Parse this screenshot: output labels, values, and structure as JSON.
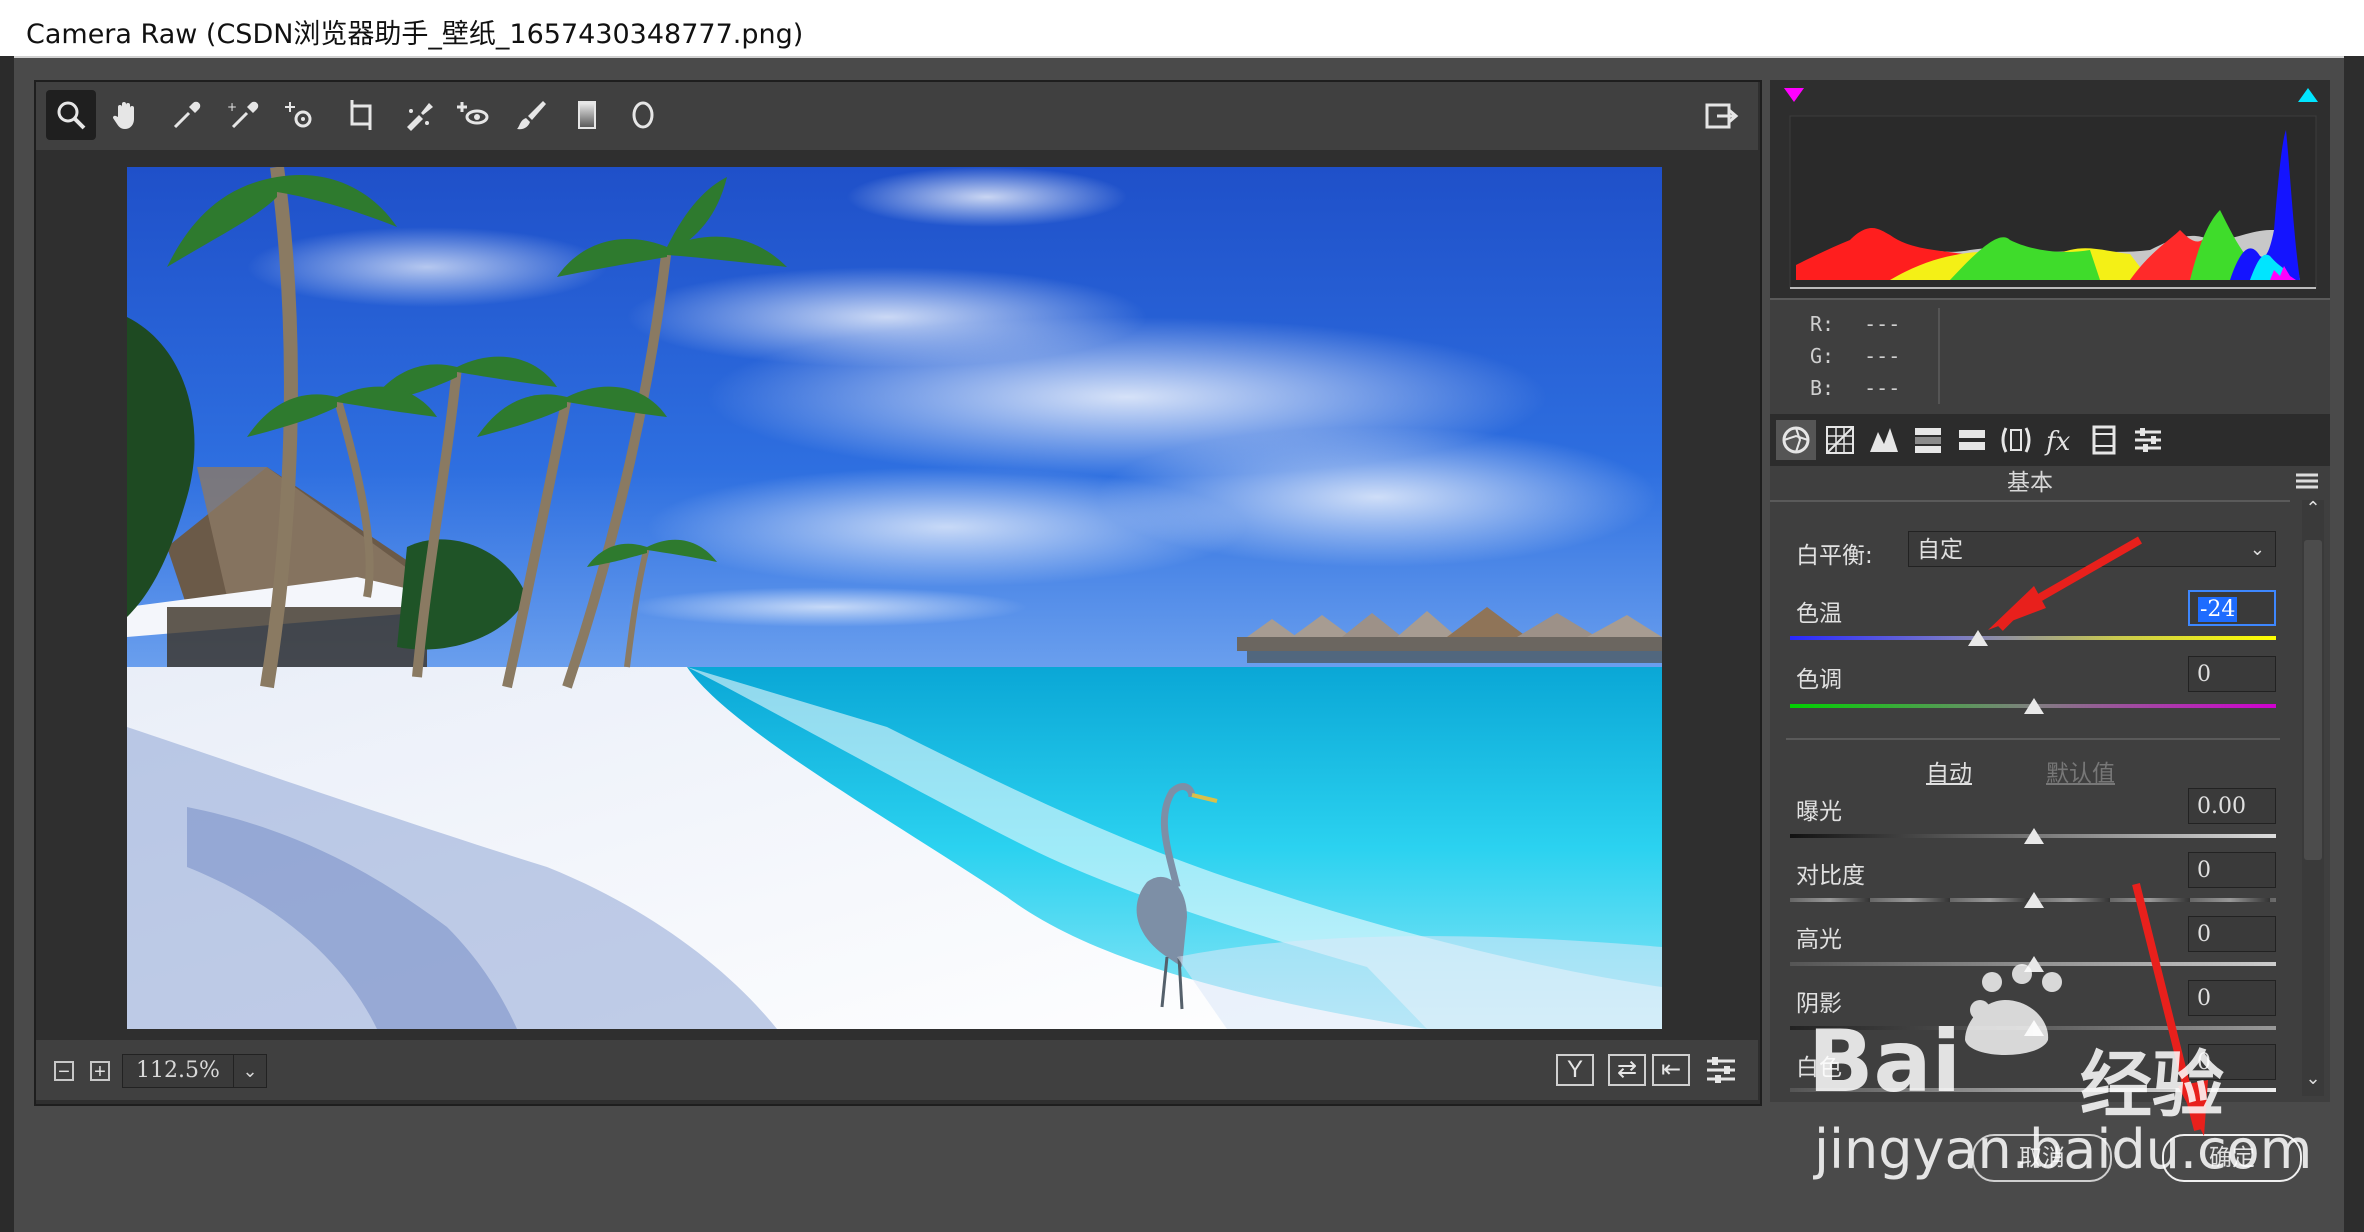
{
  "window": {
    "title": "Camera Raw (CSDN浏览器助手_壁纸_1657430348777.png)"
  },
  "toolbar": {
    "tools": [
      "zoom-icon",
      "hand-icon",
      "white-balance-icon",
      "color-sampler-icon",
      "targeted-adjust-icon",
      "crop-icon",
      "spot-removal-icon",
      "red-eye-icon",
      "adjustment-brush-icon",
      "graduated-filter-icon",
      "radial-filter-icon"
    ],
    "export_icon": "export-icon"
  },
  "zoom": {
    "value": "112.5%",
    "minus": "−",
    "plus": "+",
    "dropdown": "⌄"
  },
  "view_buttons": [
    "Y",
    "⇄",
    "⇤",
    "≡"
  ],
  "readout": {
    "r_label": "R:",
    "g_label": "G:",
    "b_label": "B:",
    "r_value": "---",
    "g_value": "---",
    "b_value": "---"
  },
  "panel": {
    "title": "基本",
    "white_balance_label": "白平衡:",
    "white_balance_value": "自定",
    "auto_label": "自动",
    "default_label": "默认值",
    "sliders": [
      {
        "label": "色温",
        "value": "-24",
        "position": 0.33
      },
      {
        "label": "色调",
        "value": "0",
        "position": 0.5
      },
      {
        "label": "曝光",
        "value": "0.00",
        "position": 0.5
      },
      {
        "label": "对比度",
        "value": "0",
        "position": 0.5
      },
      {
        "label": "高光",
        "value": "0",
        "position": 0.5
      },
      {
        "label": "阴影",
        "value": "0",
        "position": 0.5
      },
      {
        "label": "白色",
        "value": "0",
        "position": 0.5
      }
    ]
  },
  "footer": {
    "cancel_label": "取消",
    "ok_label": "确定"
  },
  "watermark": {
    "brand": "Bai",
    "brand2": "经验",
    "url": "jingyan.baidu.com"
  },
  "colors": {
    "highlight_clip": "#ff00ff",
    "shadow_clip": "#00e5ff",
    "selection": "#1e6cff",
    "annotation_arrow": "#e8201c"
  }
}
